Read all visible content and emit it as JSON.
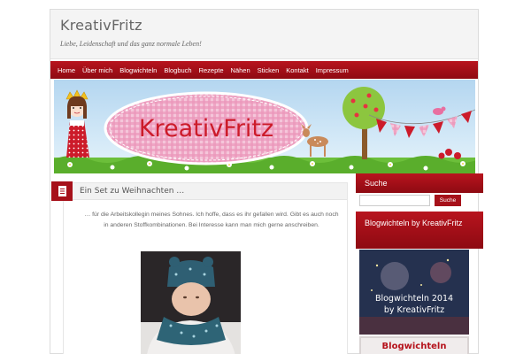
{
  "header": {
    "title": "KreativFritz",
    "tagline": "Liebe, Leidenschaft und das ganz normale Leben!"
  },
  "nav": {
    "items": [
      "Home",
      "Über mich",
      "Blogwichteln",
      "Blogbuch",
      "Rezepte",
      "Nähen",
      "Sticken",
      "Kontakt",
      "Impressum"
    ]
  },
  "banner": {
    "logo_text": "KreativFritz"
  },
  "post": {
    "title": "Ein Set zu Weihnachten …",
    "body": "… für die Arbeitskollegin meines Sohnes. Ich hoffe, dass es ihr gefallen wird. Gibt es auch noch in anderen Stoffkombinationen. Bei Interesse kann man mich gerne anschreiben.",
    "icon": "document-icon"
  },
  "sidebar": {
    "search": {
      "heading": "Suche",
      "button_label": "Suche",
      "value": ""
    },
    "blogwichteln": {
      "heading": "Blogwichteln by KreativFritz",
      "banner_line1": "Blogwichteln 2014",
      "banner_line2": "by KreativFritz",
      "badge_text": "Blogwichteln"
    }
  },
  "colors": {
    "accent_red": "#a6111a",
    "nav_red": "#b8141e",
    "sky_blue": "#b4d6f0",
    "grass_green": "#6cbf3a",
    "gingham_pink": "#e86fa0"
  }
}
